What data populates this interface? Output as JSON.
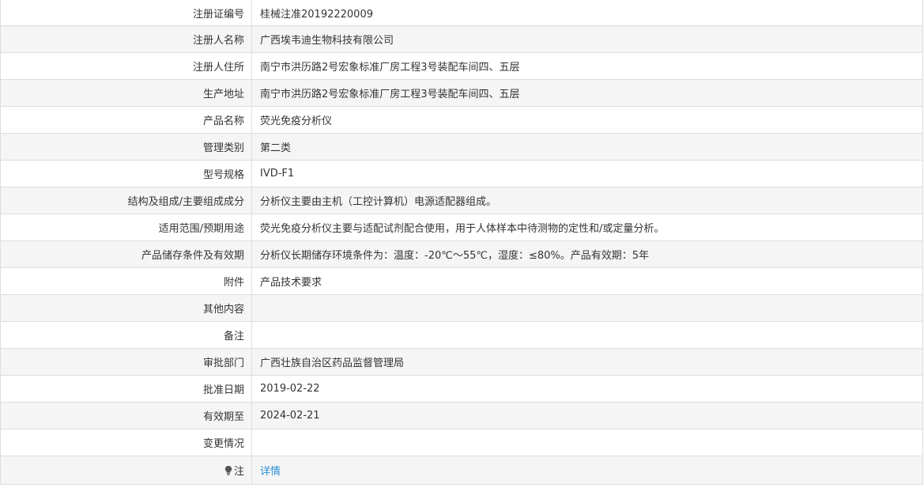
{
  "rows": [
    {
      "label": "注册证编号",
      "value": "桂械注准20192220009"
    },
    {
      "label": "注册人名称",
      "value": "广西埃韦迪生物科技有限公司"
    },
    {
      "label": "注册人住所",
      "value": "南宁市洪历路2号宏象标准厂房工程3号装配车间四、五层"
    },
    {
      "label": "生产地址",
      "value": "南宁市洪历路2号宏象标准厂房工程3号装配车间四、五层"
    },
    {
      "label": "产品名称",
      "value": "荧光免疫分析仪"
    },
    {
      "label": "管理类别",
      "value": "第二类"
    },
    {
      "label": "型号规格",
      "value": "IVD-F1"
    },
    {
      "label": "结构及组成/主要组成成分",
      "value": "分析仪主要由主机（工控计算机）电源适配器组成。"
    },
    {
      "label": "适用范围/预期用途",
      "value": "荧光免疫分析仪主要与适配试剂配合使用，用于人体样本中待测物的定性和/或定量分析。"
    },
    {
      "label": "产品储存条件及有效期",
      "value": "分析仪长期储存环境条件为：温度：-20℃～55℃，湿度：≤80%。产品有效期：5年"
    },
    {
      "label": "附件",
      "value": "产品技术要求"
    },
    {
      "label": "其他内容",
      "value": ""
    },
    {
      "label": "备注",
      "value": ""
    },
    {
      "label": "审批部门",
      "value": "广西壮族自治区药品监督管理局"
    },
    {
      "label": "批准日期",
      "value": "2019-02-22"
    },
    {
      "label": "有效期至",
      "value": "2024-02-21"
    },
    {
      "label": "变更情况",
      "value": ""
    }
  ],
  "note_row": {
    "icon": "lightbulb-icon",
    "label": "注",
    "link_text": "详情"
  },
  "colors": {
    "border": "#dddddd",
    "stripe": "#f5f5f5",
    "text": "#333333",
    "link": "#2a8fd6"
  }
}
